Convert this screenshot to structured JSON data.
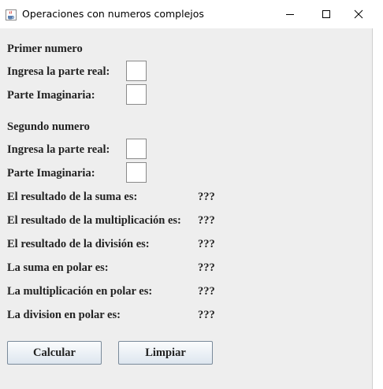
{
  "window": {
    "title": "Operaciones con numeros complejos",
    "controls": {
      "minimize": "—",
      "maximize": "☐",
      "close": "✕"
    }
  },
  "first_number": {
    "heading": "Primer numero",
    "real_label": "Ingresa la parte real:",
    "imag_label": "Parte Imaginaria:",
    "real_value": "",
    "imag_value": ""
  },
  "second_number": {
    "heading": "Segundo numero",
    "real_label": "Ingresa la parte real:",
    "imag_label": "Parte Imaginaria:",
    "real_value": "",
    "imag_value": ""
  },
  "results": [
    {
      "label": "El resultado de la suma es:",
      "value": "???"
    },
    {
      "label": "El resultado de la multiplicación es:",
      "value": "???"
    },
    {
      "label": "El resultado de la división es:",
      "value": "???"
    },
    {
      "label": "La suma en polar es:",
      "value": "???"
    },
    {
      "label": "La multiplicación en polar es:",
      "value": "???"
    },
    {
      "label": "La division en polar es:",
      "value": "???"
    }
  ],
  "buttons": {
    "calculate": "Calcular",
    "clear": "Limpiar"
  }
}
